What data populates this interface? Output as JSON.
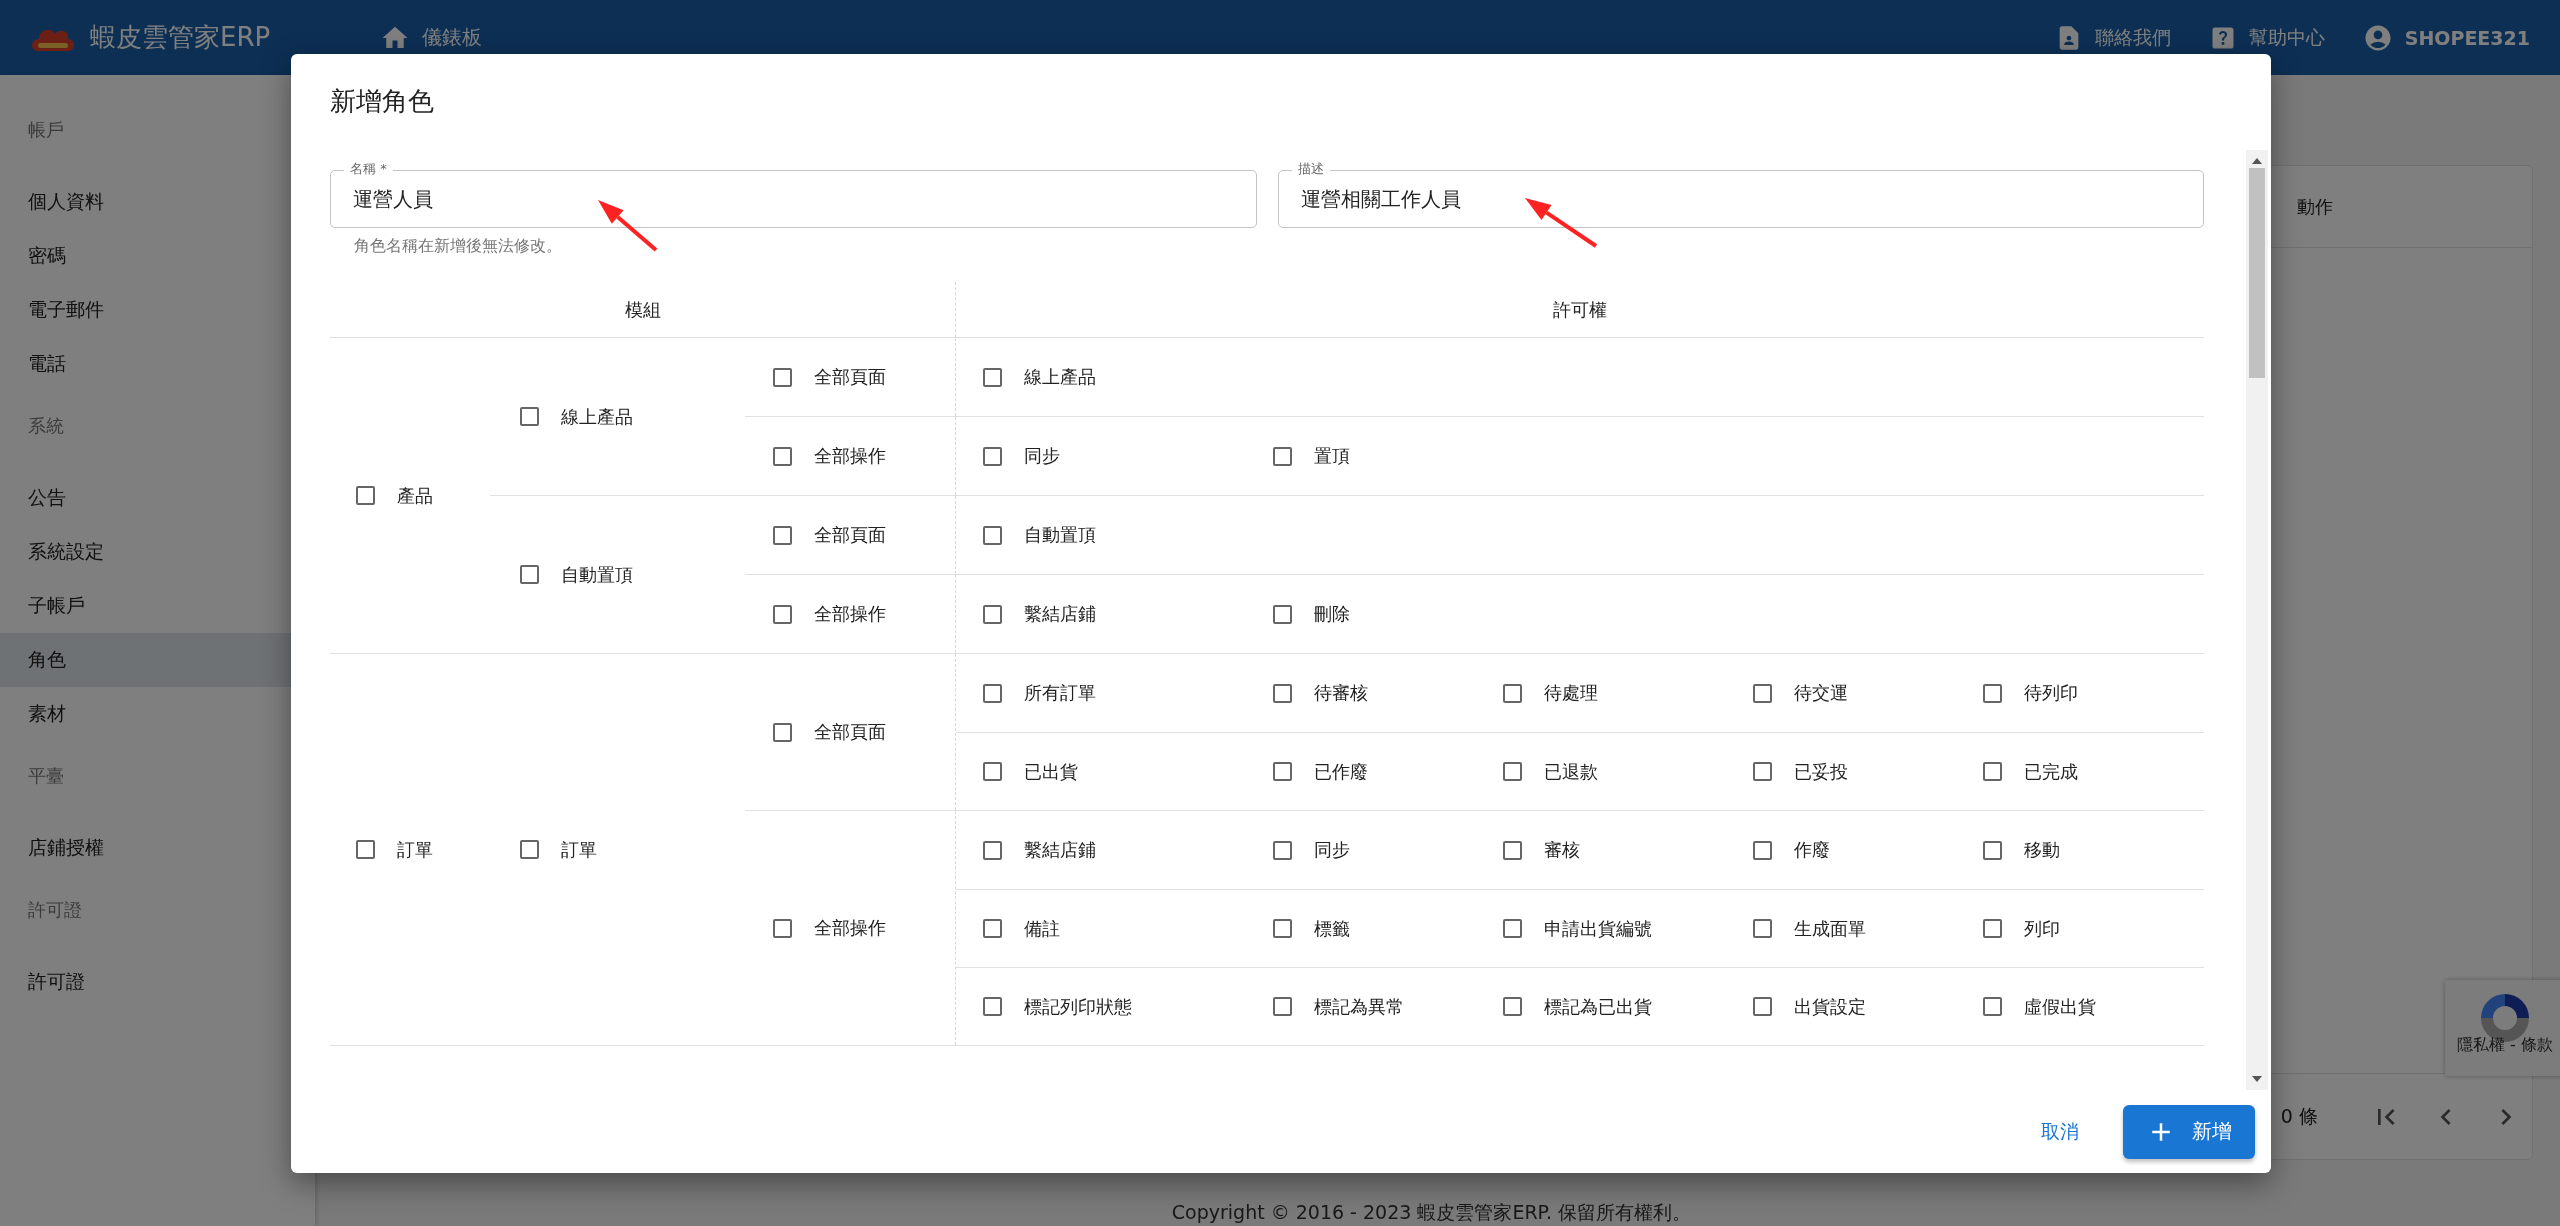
{
  "app": {
    "title": "蝦皮雲管家ERP"
  },
  "topbar": {
    "nav": [
      {
        "kind": "home",
        "label": "儀錶板"
      }
    ],
    "actions": [
      {
        "kind": "contact",
        "label": "聯絡我們"
      },
      {
        "kind": "help",
        "label": "幫助中心"
      },
      {
        "kind": "account",
        "label": "SHOPEE321"
      }
    ]
  },
  "sidebar": {
    "sections": [
      {
        "title": "帳戶",
        "items": [
          {
            "label": "個人資料",
            "selected": false
          },
          {
            "label": "密碼",
            "selected": false
          },
          {
            "label": "電子郵件",
            "selected": false
          },
          {
            "label": "電話",
            "selected": false
          }
        ]
      },
      {
        "title": "系統",
        "items": [
          {
            "label": "公告",
            "selected": false
          },
          {
            "label": "系統設定",
            "selected": false
          },
          {
            "label": "子帳戶",
            "selected": false
          },
          {
            "label": "角色",
            "selected": true
          },
          {
            "label": "素材",
            "selected": false
          }
        ]
      },
      {
        "title": "平臺",
        "items": [
          {
            "label": "店鋪授權",
            "selected": false
          }
        ]
      },
      {
        "title": "許可證",
        "items": [
          {
            "label": "許可證",
            "selected": false
          }
        ]
      }
    ]
  },
  "content": {
    "table": {
      "columns": [
        "動作"
      ]
    },
    "pagination": {
      "total": "0 條"
    }
  },
  "footer": "Copyright © 2016 - 2023 蝦皮雲管家ERP. 保留所有權利。",
  "recaptcha": {
    "label": "隱私權 - 條款"
  },
  "dialog": {
    "title": "新增角色",
    "fields": [
      {
        "label": "名稱 *",
        "value": "運營人員",
        "helper": "角色名稱在新增後無法修改。"
      },
      {
        "label": "描述",
        "value": "運營相關工作人員"
      }
    ],
    "permissions": {
      "columns": [
        "模組",
        "許可權"
      ],
      "modules": [
        {
          "label": "產品",
          "checked": false,
          "submodules": [
            {
              "label": "線上產品",
              "checked": false,
              "rows": [
                {
                  "label": "全部頁面",
                  "checked": false,
                  "lines": [
                    [
                      {
                        "label": "線上產品",
                        "checked": false
                      }
                    ]
                  ]
                },
                {
                  "label": "全部操作",
                  "checked": false,
                  "lines": [
                    [
                      {
                        "label": "同步",
                        "checked": false
                      },
                      {
                        "label": "置頂",
                        "checked": false
                      }
                    ]
                  ]
                }
              ]
            },
            {
              "label": "自動置頂",
              "checked": false,
              "rows": [
                {
                  "label": "全部頁面",
                  "checked": false,
                  "lines": [
                    [
                      {
                        "label": "自動置頂",
                        "checked": false
                      }
                    ]
                  ]
                },
                {
                  "label": "全部操作",
                  "checked": false,
                  "lines": [
                    [
                      {
                        "label": "繫結店鋪",
                        "checked": false
                      },
                      {
                        "label": "刪除",
                        "checked": false
                      }
                    ]
                  ]
                }
              ]
            }
          ]
        },
        {
          "label": "訂單",
          "checked": false,
          "submodules": [
            {
              "label": "訂單",
              "checked": false,
              "rows": [
                {
                  "label": "全部頁面",
                  "checked": false,
                  "lines": [
                    [
                      {
                        "label": "所有訂單",
                        "checked": false
                      },
                      {
                        "label": "待審核",
                        "checked": false
                      },
                      {
                        "label": "待處理",
                        "checked": false
                      },
                      {
                        "label": "待交運",
                        "checked": false
                      },
                      {
                        "label": "待列印",
                        "checked": false
                      }
                    ],
                    [
                      {
                        "label": "已出貨",
                        "checked": false
                      },
                      {
                        "label": "已作廢",
                        "checked": false
                      },
                      {
                        "label": "已退款",
                        "checked": false
                      },
                      {
                        "label": "已妥投",
                        "checked": false
                      },
                      {
                        "label": "已完成",
                        "checked": false
                      }
                    ]
                  ]
                },
                {
                  "label": "全部操作",
                  "checked": false,
                  "lines": [
                    [
                      {
                        "label": "繫結店鋪",
                        "checked": false
                      },
                      {
                        "label": "同步",
                        "checked": false
                      },
                      {
                        "label": "審核",
                        "checked": false
                      },
                      {
                        "label": "作廢",
                        "checked": false
                      },
                      {
                        "label": "移動",
                        "checked": false
                      }
                    ],
                    [
                      {
                        "label": "備註",
                        "checked": false
                      },
                      {
                        "label": "標籤",
                        "checked": false
                      },
                      {
                        "label": "申請出貨編號",
                        "checked": false
                      },
                      {
                        "label": "生成面單",
                        "checked": false
                      },
                      {
                        "label": "列印",
                        "checked": false
                      }
                    ],
                    [
                      {
                        "label": "標記列印狀態",
                        "checked": false
                      },
                      {
                        "label": "標記為異常",
                        "checked": false
                      },
                      {
                        "label": "標記為已出貨",
                        "checked": false
                      },
                      {
                        "label": "出貨設定",
                        "checked": false
                      },
                      {
                        "label": "虛假出貨",
                        "checked": false
                      }
                    ]
                  ]
                }
              ]
            }
          ]
        }
      ]
    },
    "buttons": [
      {
        "kind": "text",
        "label": "取消"
      },
      {
        "kind": "primary",
        "label": "新增"
      }
    ]
  }
}
